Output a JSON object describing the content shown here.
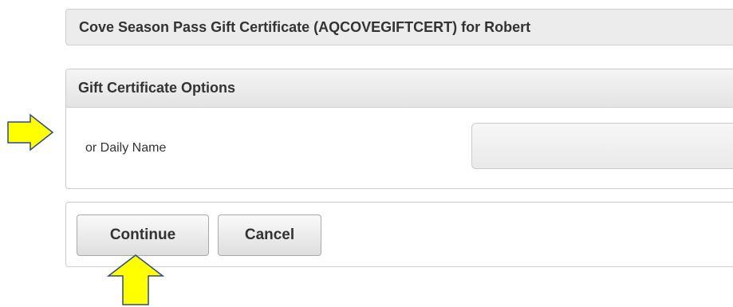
{
  "title_bar": {
    "text": "Cove Season Pass Gift Certificate (AQCOVEGIFTCERT) for Robert"
  },
  "options_panel": {
    "header": "Gift Certificate Options",
    "field_label": "or Daily Name",
    "field_value": ""
  },
  "actions": {
    "continue_label": "Continue",
    "cancel_label": "Cancel"
  },
  "annotations": {
    "arrow_color": "#ffff00",
    "arrow_outline": "#2e4a8a",
    "arrows": [
      "arrow-right-icon",
      "arrow-up-icon"
    ]
  }
}
